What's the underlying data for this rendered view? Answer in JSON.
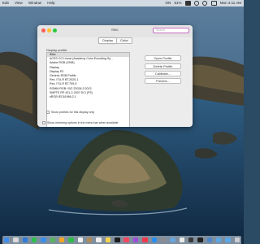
{
  "menubar": {
    "left_items": [
      "Edit",
      "View",
      "Window",
      "Help"
    ],
    "right_items": [
      "ON",
      "51%",
      "Mon 4:11 AM"
    ],
    "status_icons": [
      "battery-icon",
      "wifi-icon",
      "search-icon",
      "control-center-icon"
    ]
  },
  "window": {
    "title": "Mac",
    "search_placeholder": "Search",
    "tabs": [
      {
        "label": "Display",
        "active": true
      },
      {
        "label": "Color",
        "active": false
      }
    ],
    "group_label": "Display profile:",
    "profiles": [
      "iMac",
      "ACES CG Linear (Academy Color Encoding Sy...",
      "Adobe RGB (1998)",
      "Display",
      "Display P3",
      "Generic RGB Profile",
      "Rec. ITU-R BT.2020-1",
      "Rec. ITU-R BT.709-5",
      "ROMM RGB: ISO 22028-2:2013",
      "SMPTE RP 431-2-2007 DCI (P3)",
      "sRGB IEC61966-2.1"
    ],
    "selected_index": 0,
    "buttons": {
      "open": "Open Profile",
      "delete": "Delete Profile",
      "calibrate": "Calibrate...",
      "presets": "Presets..."
    },
    "show_profiles_label": "Show profiles for this display only",
    "mirroring_label": "Show mirroring options in the menu bar when available"
  },
  "colors": {
    "search_focus": "#c86bc0",
    "close": "#ff5f57",
    "minimize": "#ffbd2e",
    "zoom": "#28c840"
  },
  "dock_apps": [
    {
      "name": "finder-icon",
      "color": "#3d8ef0"
    },
    {
      "name": "launchpad-icon",
      "color": "#d9d9d9"
    },
    {
      "name": "safari-icon",
      "color": "#2e7bd9"
    },
    {
      "name": "messages-icon",
      "color": "#2fbf4f"
    },
    {
      "name": "mail-icon",
      "color": "#3b8fea"
    },
    {
      "name": "maps-icon",
      "color": "#57b55c"
    },
    {
      "name": "photos-icon",
      "color": "#f5a623"
    },
    {
      "name": "facetime-icon",
      "color": "#2ebd49"
    },
    {
      "name": "calendar-icon",
      "color": "#f2f2f2"
    },
    {
      "name": "contacts-icon",
      "color": "#b08b5a"
    },
    {
      "name": "reminders-icon",
      "color": "#efefef"
    },
    {
      "name": "notes-icon",
      "color": "#f7d34a"
    },
    {
      "name": "tv-icon",
      "color": "#1c1c1c"
    },
    {
      "name": "music-icon",
      "color": "#f2485e"
    },
    {
      "name": "podcasts-icon",
      "color": "#9b4fd8"
    },
    {
      "name": "news-icon",
      "color": "#f0384c"
    },
    {
      "name": "app-store-icon",
      "color": "#2b8ff0"
    },
    {
      "name": "system-preferences-icon",
      "color": "#8d8d93"
    },
    {
      "name": "preview-icon",
      "color": "#6aa4d8"
    },
    {
      "name": "textedit-icon",
      "color": "#eaeaea"
    },
    {
      "name": "activity-monitor-icon",
      "color": "#3a3a3a"
    },
    {
      "name": "terminal-icon",
      "color": "#222222"
    },
    {
      "name": "utilities-icon",
      "color": "#4d88c9"
    },
    {
      "name": "downloads-folder-icon",
      "color": "#5aa8e6"
    },
    {
      "name": "documents-folder-icon",
      "color": "#5aa8e6"
    },
    {
      "name": "trash-icon",
      "color": "#c9ced4"
    }
  ]
}
